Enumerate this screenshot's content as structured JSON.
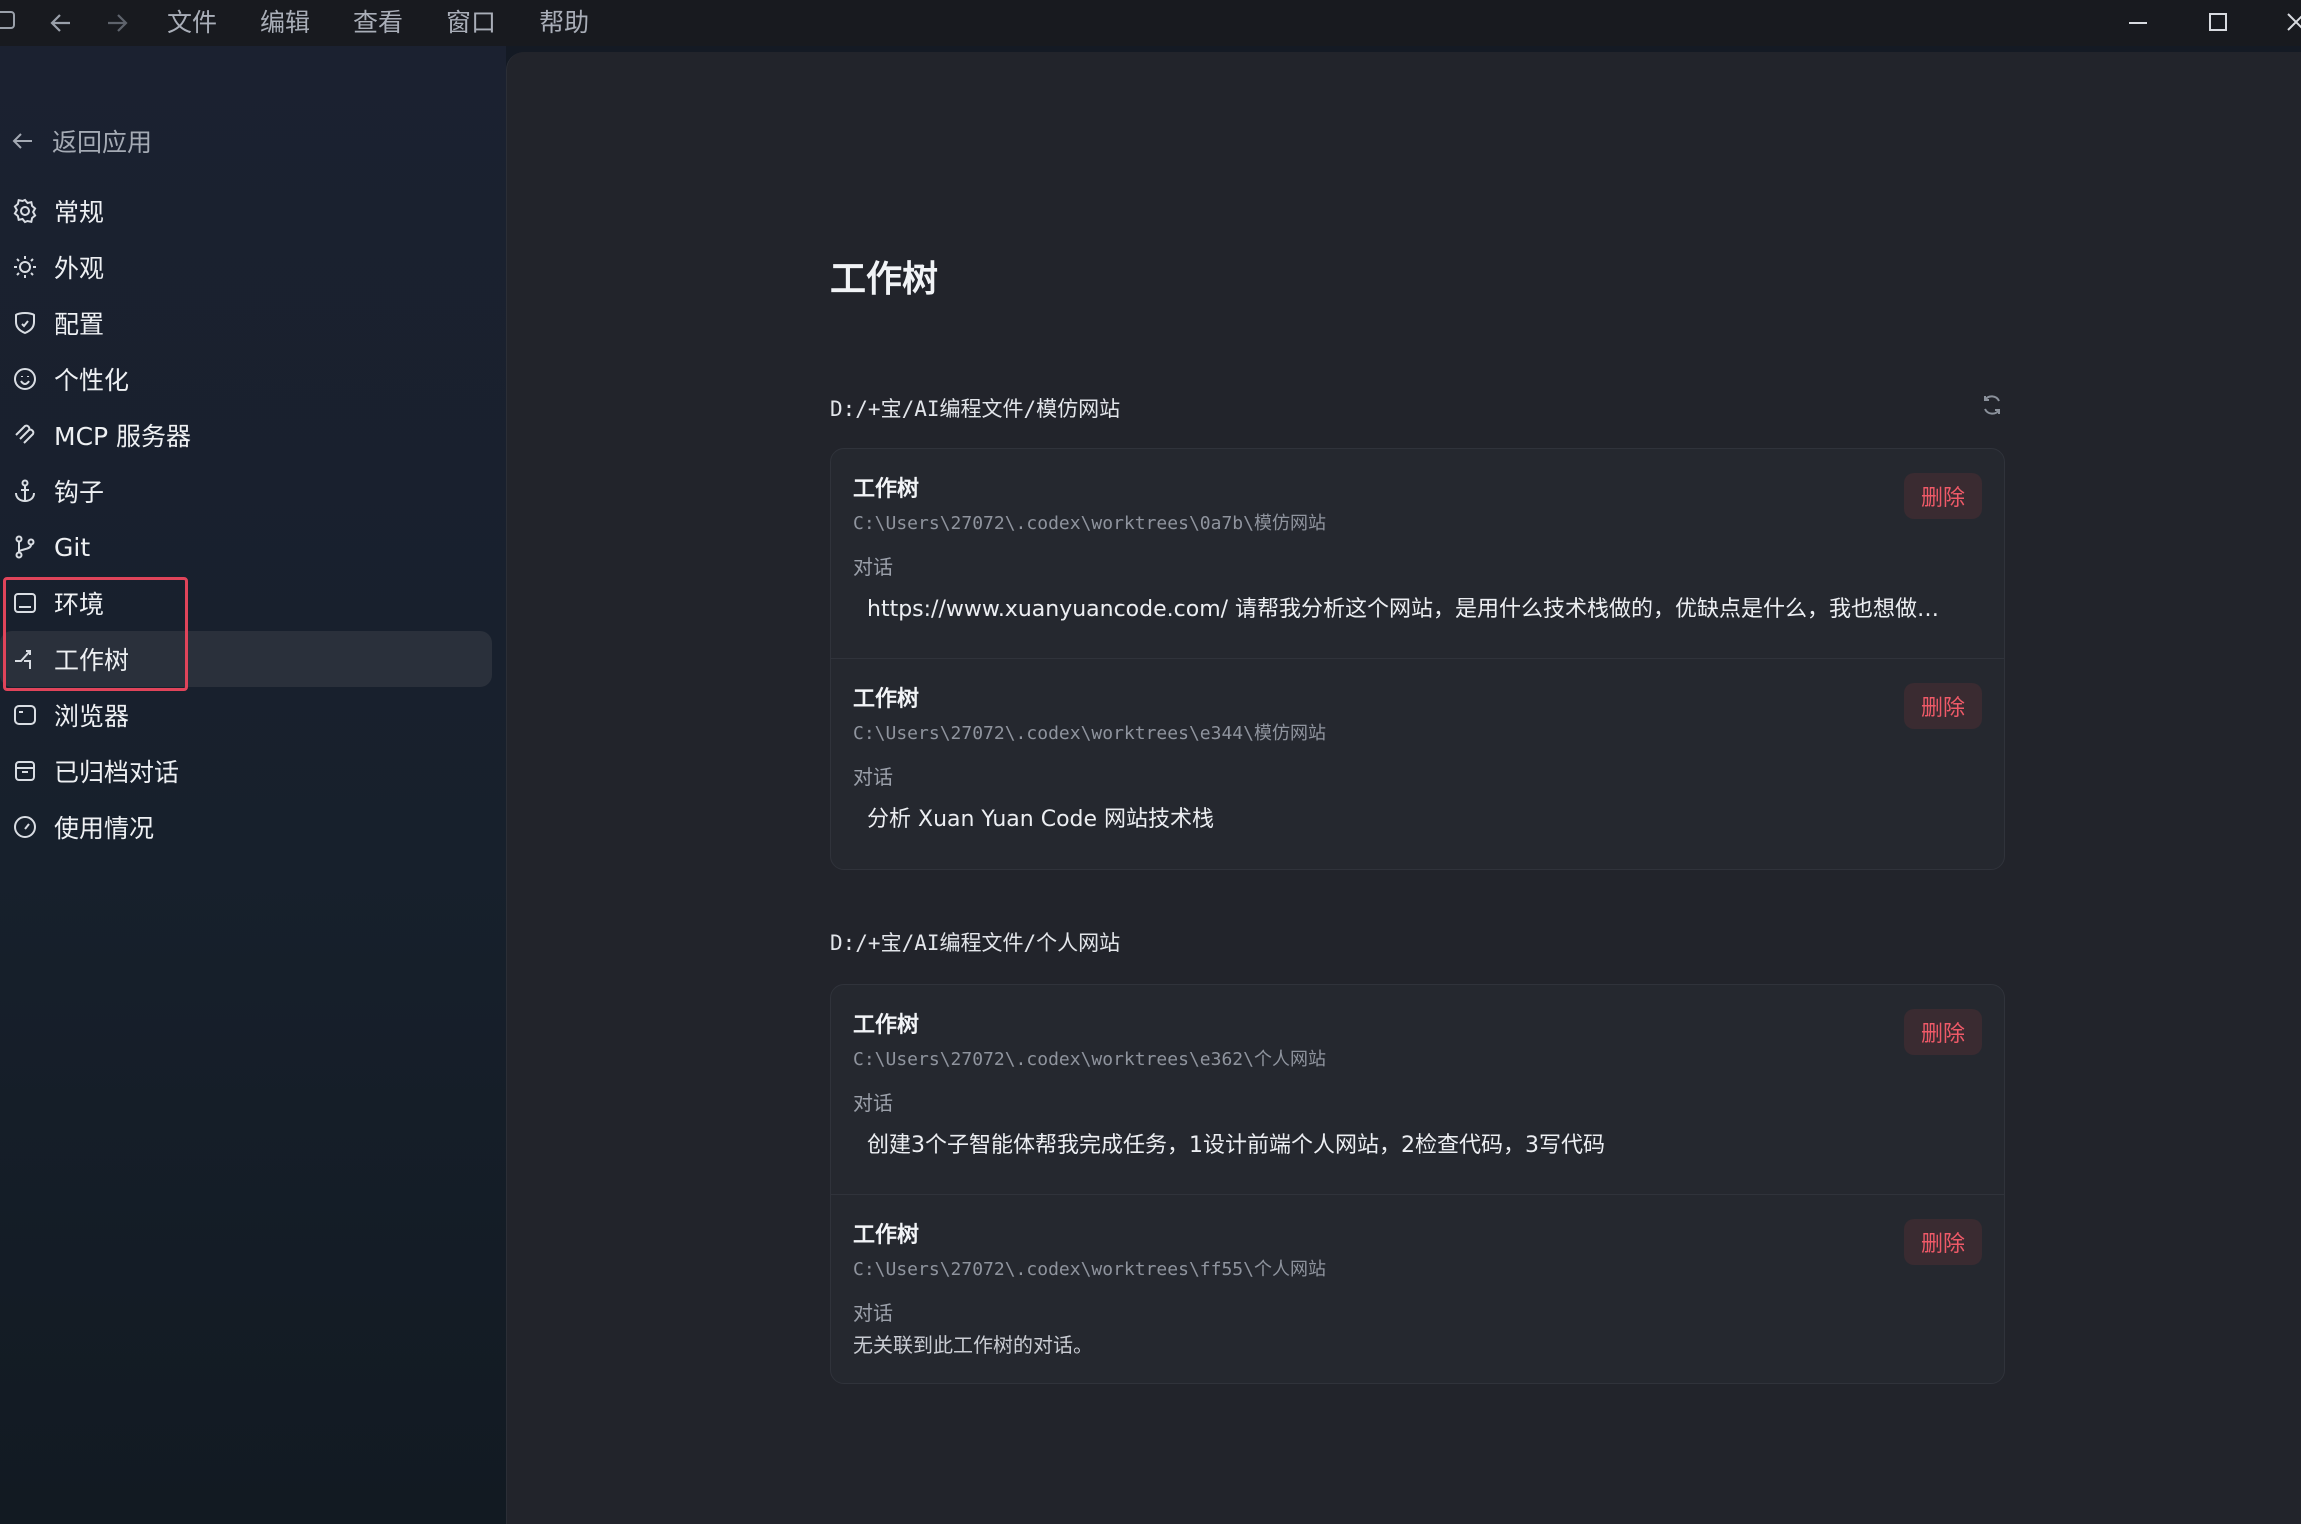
{
  "titlebar": {
    "menu": [
      "文件",
      "编辑",
      "查看",
      "窗口",
      "帮助"
    ]
  },
  "sidebar": {
    "back_label": "返回应用",
    "items": [
      {
        "label": "常规",
        "icon": "gear-icon"
      },
      {
        "label": "外观",
        "icon": "sun-icon"
      },
      {
        "label": "配置",
        "icon": "shield-icon"
      },
      {
        "label": "个性化",
        "icon": "smile-icon"
      },
      {
        "label": "MCP 服务器",
        "icon": "mcp-icon"
      },
      {
        "label": "钩子",
        "icon": "anchor-icon"
      },
      {
        "label": "Git",
        "icon": "git-branch-icon"
      },
      {
        "label": "环境",
        "icon": "terminal-box-icon"
      },
      {
        "label": "工作树",
        "icon": "worktree-icon",
        "active": true
      },
      {
        "label": "浏览器",
        "icon": "browser-icon"
      },
      {
        "label": "已归档对话",
        "icon": "archive-icon"
      },
      {
        "label": "使用情况",
        "icon": "gauge-icon"
      }
    ]
  },
  "main": {
    "title": "工作树",
    "groups": [
      {
        "path": "D:/+宝/AI编程文件/模仿网站",
        "worktrees": [
          {
            "title": "工作树",
            "path": "C:\\Users\\27072\\.codex\\worktrees\\0a7b\\模仿网站",
            "conversation_label": "对话",
            "conversation": "https://www.xuanyuancode.com/ 请帮我分析这个网站，是用什么技术栈做的，优缺点是什么，我也想做一...",
            "delete_label": "删除"
          },
          {
            "title": "工作树",
            "path": "C:\\Users\\27072\\.codex\\worktrees\\e344\\模仿网站",
            "conversation_label": "对话",
            "conversation": "分析 Xuan Yuan Code 网站技术栈",
            "delete_label": "删除"
          }
        ]
      },
      {
        "path": "D:/+宝/AI编程文件/个人网站",
        "worktrees": [
          {
            "title": "工作树",
            "path": "C:\\Users\\27072\\.codex\\worktrees\\e362\\个人网站",
            "conversation_label": "对话",
            "conversation": "创建3个子智能体帮我完成任务，1设计前端个人网站，2检查代码，3写代码",
            "delete_label": "删除"
          },
          {
            "title": "工作树",
            "path": "C:\\Users\\27072\\.codex\\worktrees\\ff55\\个人网站",
            "conversation_label": "对话",
            "conversation": "无关联到此工作树的对话。",
            "delete_label": "删除"
          }
        ]
      }
    ]
  },
  "colors": {
    "accent_delete": "#ef5a68",
    "highlight": "#e0445a"
  }
}
